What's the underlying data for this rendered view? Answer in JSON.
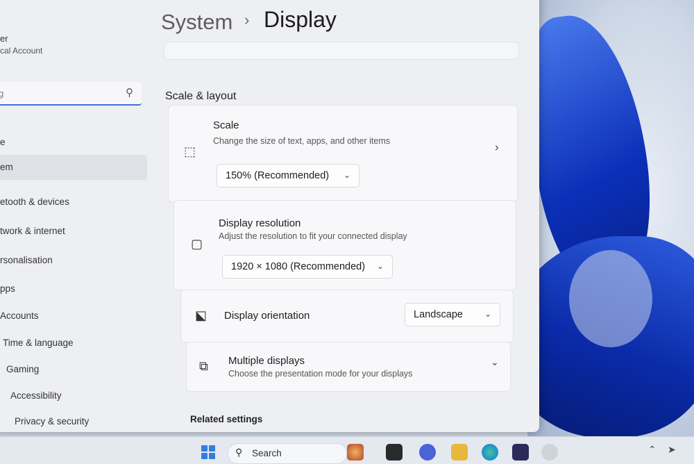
{
  "window": {
    "breadcrumb_parent": "System",
    "breadcrumb_sep": "›",
    "breadcrumb_current": "Display"
  },
  "nav": {
    "profile_name": "er",
    "profile_sub": "cal Account",
    "search_placeholder": "g",
    "items": [
      {
        "label": "e"
      },
      {
        "label": "em"
      },
      {
        "label": "etooth & devices"
      },
      {
        "label": "twork & internet"
      },
      {
        "label": "rsonalisation"
      },
      {
        "label": "pps"
      },
      {
        "label": "Accounts"
      },
      {
        "label": "Time & language"
      },
      {
        "label": "Gaming"
      },
      {
        "label": "Accessibility"
      },
      {
        "label": "Privacy & security"
      }
    ]
  },
  "content": {
    "section_title": "Scale & layout",
    "scale": {
      "title": "Scale",
      "subtitle": "Change the size of text, apps, and other items",
      "value": "150% (Recommended)"
    },
    "resolution": {
      "title": "Display resolution",
      "subtitle": "Adjust the resolution to fit your connected display",
      "value": "1920 × 1080 (Recommended)"
    },
    "orientation": {
      "title": "Display orientation",
      "value": "Landscape"
    },
    "multiple": {
      "title": "Multiple displays",
      "subtitle": "Choose the presentation mode for your displays"
    },
    "related_title": "Related settings"
  },
  "taskbar": {
    "search_label": "Search"
  },
  "icons": {
    "scale": "scale-icon",
    "resolution": "resolution-icon",
    "orientation": "orientation-icon",
    "multiple": "multiple-displays-icon"
  },
  "colors": {
    "accent": "#3c6fd8",
    "window_bg": "#eeeff3",
    "card_bg": "#f8f8fa"
  }
}
